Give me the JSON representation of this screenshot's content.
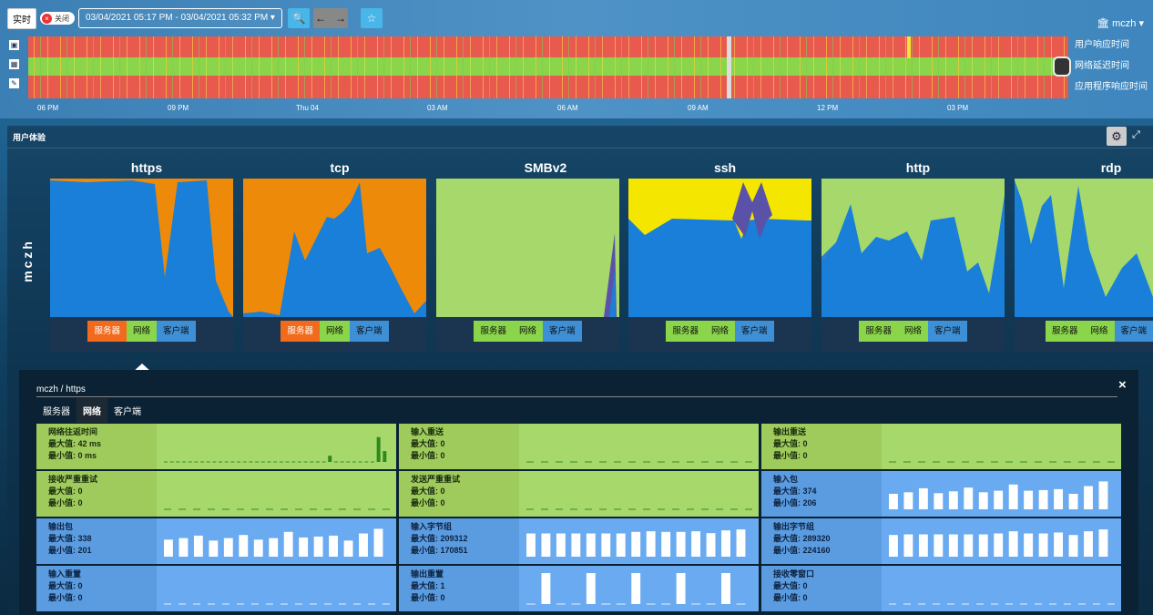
{
  "toolbar": {
    "live": "实时",
    "toggle": "关闭",
    "range": "03/04/2021 05:17 PM - 03/04/2021 05:32 PM",
    "user": "mczh"
  },
  "timeline": {
    "labels": [
      "用户响应时间",
      "网络延迟时间",
      "应用程序响应时间"
    ],
    "times": [
      "06 PM",
      "09 PM",
      "Thu 04",
      "03 AM",
      "06 AM",
      "09 AM",
      "12 PM",
      "03 PM"
    ]
  },
  "panel": {
    "title": "用户体验",
    "group": "mczh"
  },
  "legend": {
    "server": "服务器",
    "network": "网络",
    "client": "客户端"
  },
  "protocols": [
    "https",
    "tcp",
    "SMBv2",
    "ssh",
    "http",
    "rdp"
  ],
  "colors": {
    "server": "#ee8a0a",
    "network": "#a6d86c",
    "client": "#1a7fd8",
    "alt1": "#f5e600",
    "alt2": "#5a52a8"
  },
  "detail": {
    "path": "mczh / https",
    "tabs": [
      "服务器",
      "网络",
      "客户端"
    ],
    "active_tab": "网络",
    "max_label": "最大值:",
    "min_label": "最小值:",
    "metrics": [
      {
        "name": "网络往返时间",
        "max": "42 ms",
        "min": "0 ms",
        "color": "green",
        "bars": [
          0,
          0,
          0,
          0,
          0,
          0,
          0,
          0,
          0,
          0,
          0,
          0,
          0,
          0,
          0,
          0,
          0,
          0,
          0,
          0,
          0,
          0,
          0,
          0,
          0,
          0,
          0,
          20,
          0,
          0,
          0,
          0,
          0,
          0,
          0,
          80,
          35
        ]
      },
      {
        "name": "输入重送",
        "max": "0",
        "min": "0",
        "color": "green",
        "bars": []
      },
      {
        "name": "输出重送",
        "max": "0",
        "min": "0",
        "color": "green",
        "bars": []
      },
      {
        "name": "接收严重重试",
        "max": "0",
        "min": "0",
        "color": "green",
        "bars": []
      },
      {
        "name": "发送严重重试",
        "max": "0",
        "min": "0",
        "color": "green",
        "bars": []
      },
      {
        "name": "输入包",
        "max": "374",
        "min": "206",
        "color": "blue",
        "bars": [
          50,
          55,
          68,
          52,
          58,
          70,
          55,
          60,
          80,
          60,
          62,
          65,
          50,
          75,
          90
        ]
      },
      {
        "name": "输出包",
        "max": "338",
        "min": "201",
        "color": "blue",
        "bars": [
          55,
          60,
          68,
          52,
          60,
          70,
          55,
          60,
          80,
          62,
          65,
          68,
          52,
          75,
          90
        ]
      },
      {
        "name": "输入字节组",
        "max": "209312",
        "min": "170851",
        "color": "blue",
        "bars": [
          75,
          75,
          75,
          75,
          75,
          75,
          75,
          80,
          82,
          80,
          80,
          82,
          76,
          85,
          88
        ]
      },
      {
        "name": "输出字节组",
        "max": "289320",
        "min": "224160",
        "color": "blue",
        "bars": [
          70,
          72,
          72,
          72,
          72,
          72,
          72,
          75,
          82,
          75,
          75,
          78,
          70,
          82,
          88
        ]
      },
      {
        "name": "输入重置",
        "max": "0",
        "min": "0",
        "color": "blue",
        "bars": []
      },
      {
        "name": "输出重置",
        "max": "1",
        "min": "0",
        "color": "blue",
        "bars": [
          0,
          100,
          0,
          0,
          100,
          0,
          0,
          100,
          0,
          0,
          100,
          0,
          0,
          100,
          0
        ]
      },
      {
        "name": "接收零窗口",
        "max": "0",
        "min": "0",
        "color": "blue",
        "bars": []
      }
    ]
  }
}
